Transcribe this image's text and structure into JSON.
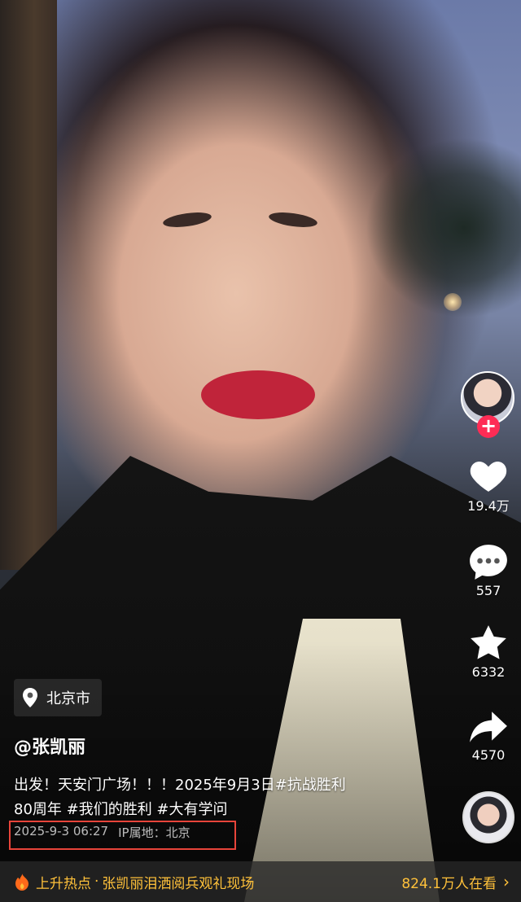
{
  "video": {
    "description_hidden": ""
  },
  "actions": {
    "likes": "19.4万",
    "comments": "557",
    "favorites": "6332",
    "shares": "4570",
    "follow_symbol": "+"
  },
  "location": {
    "label": "北京市"
  },
  "author": {
    "handle": "@张凯丽"
  },
  "caption": {
    "line1": "出发！天安门广场！！！2025年9月3日#抗战胜利",
    "line2": "80周年 #我们的胜利 #大有学问"
  },
  "meta": {
    "datetime": "2025-9-3 06:27",
    "ip": "IP属地：北京"
  },
  "trending": {
    "prefix": "上升热点",
    "separator": "·",
    "topic": "张凯丽泪洒阅兵观礼现场",
    "viewers": "824.1万人在看",
    "chevron": "›"
  },
  "colors": {
    "accent": "#fe2c55",
    "trend": "#ffc13a",
    "highlight_box": "#e8443a"
  }
}
